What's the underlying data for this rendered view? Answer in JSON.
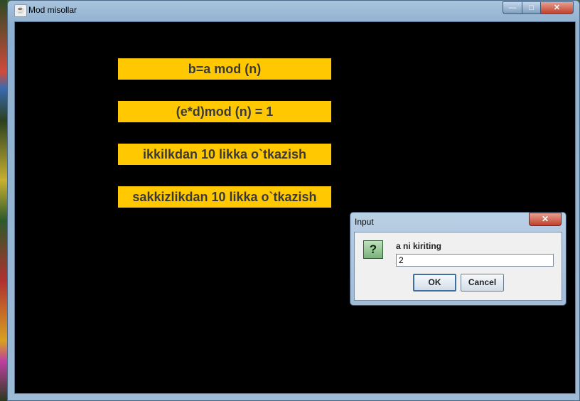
{
  "window": {
    "title": "Mod misollar",
    "app_icon": "java-icon",
    "controls": {
      "minimize": "—",
      "maximize": "□",
      "close": "✕"
    }
  },
  "main": {
    "buttons": [
      {
        "label": "b=a mod (n)"
      },
      {
        "label": "(e*d)mod (n) = 1"
      },
      {
        "label": "ikkilkdan 10 likka o`tkazish"
      },
      {
        "label": "sakkizlikdan 10 likka o`tkazish"
      }
    ],
    "button_color": "#ffc800",
    "background_color": "#000000"
  },
  "dialog": {
    "title": "Input",
    "close": "✕",
    "icon": "?",
    "prompt": "a ni kiriting",
    "input_value": "2",
    "ok_label": "OK",
    "cancel_label": "Cancel"
  }
}
